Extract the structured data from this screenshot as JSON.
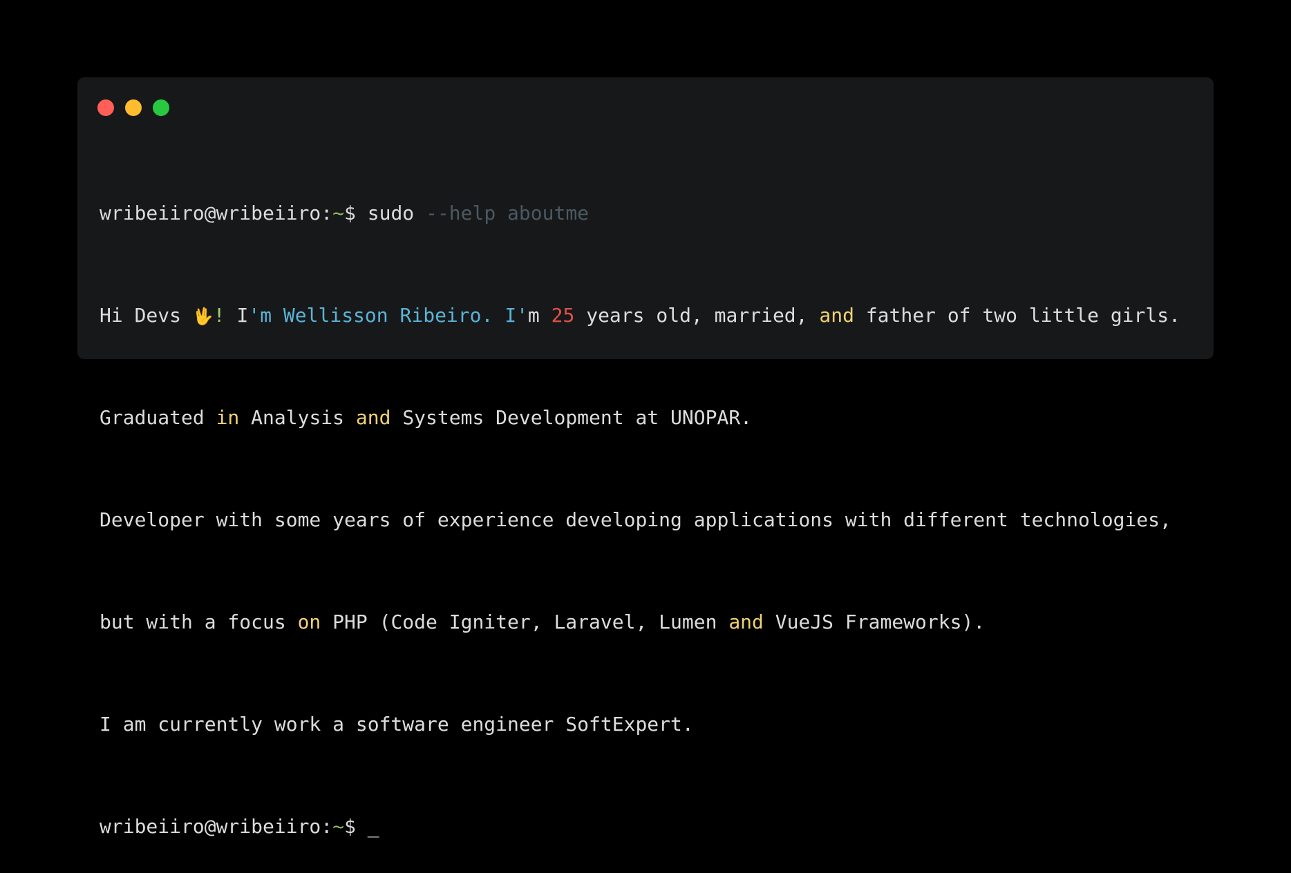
{
  "window": {
    "controls": [
      {
        "name": "close",
        "color": "#ff5f57"
      },
      {
        "name": "minimize",
        "color": "#febc2e"
      },
      {
        "name": "maximize",
        "color": "#28c840"
      }
    ]
  },
  "terminal": {
    "prompt": {
      "user_host": "wribeiiro@wribeiiro:",
      "path": "~",
      "symbol": "$"
    },
    "command": {
      "name": "sudo",
      "args": "--help aboutme"
    },
    "output": {
      "line1": {
        "greeting": "Hi Devs",
        "emoji": "🖖",
        "excl": "!",
        "i1": "I",
        "name_part": "'m Wellisson Ribeiro. I'",
        "m": "m",
        "age": "25",
        "t1": "years old, married,",
        "and": "and",
        "t2": "father of two little girls."
      },
      "line2": {
        "t1": "Graduated",
        "in": "in",
        "t2": "Analysis",
        "and": "and",
        "t3": "Systems Development at UNOPAR."
      },
      "line3": "Developer with some years of experience developing applications with different technologies,",
      "line4": {
        "t1": "but with a focus",
        "on": "on",
        "t2": "PHP (Code Igniter, Laravel, Lumen",
        "and": "and",
        "t3": "VueJS Frameworks)."
      },
      "line5": "I am currently work a software engineer SoftExpert."
    },
    "cursor": "_"
  }
}
